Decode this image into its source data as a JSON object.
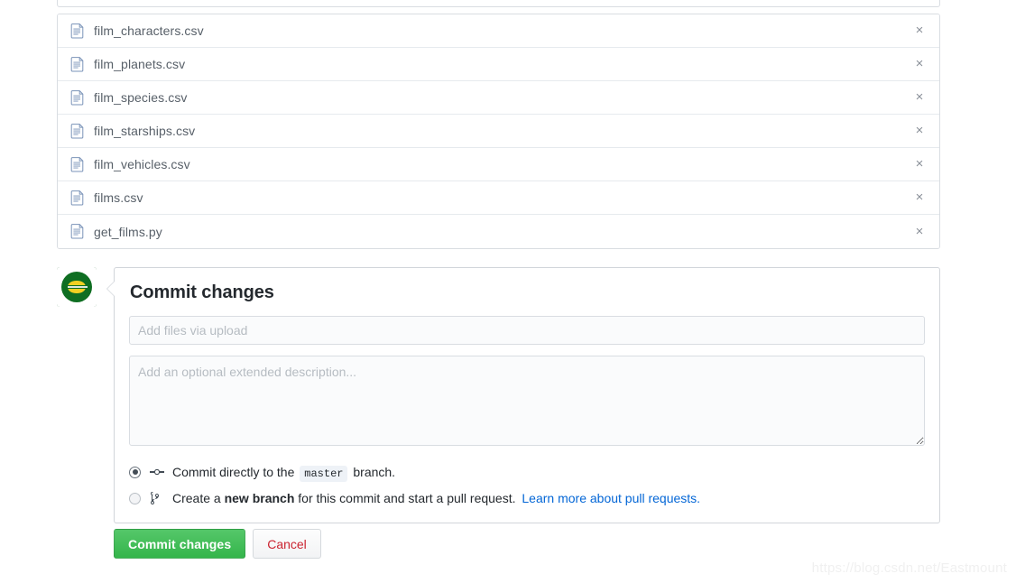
{
  "file_list": {
    "remove_icon": "close-icon",
    "file_icon": "file-document-icon",
    "remove_label": "×",
    "files": [
      {
        "name": "film_characters.csv"
      },
      {
        "name": "film_planets.csv"
      },
      {
        "name": "film_species.csv"
      },
      {
        "name": "film_starships.csv"
      },
      {
        "name": "film_vehicles.csv"
      },
      {
        "name": "films.csv"
      },
      {
        "name": "get_films.py"
      }
    ]
  },
  "avatar": {
    "icon": "user-avatar-logo",
    "colors": {
      "background": "#0b5c1f",
      "accent": "#f2d022"
    }
  },
  "commit_box": {
    "title": "Commit changes",
    "summary": {
      "value": "",
      "placeholder": "Add files via upload"
    },
    "description": {
      "value": "",
      "placeholder": "Add an optional extended description..."
    },
    "options": [
      {
        "id": "commit-directly",
        "selected": true,
        "icon": "git-commit-icon",
        "text_before": "Commit directly to the",
        "branch": "master",
        "text_after": "branch."
      },
      {
        "id": "create-new-branch",
        "selected": false,
        "icon": "git-branch-icon",
        "text_before": "Create a",
        "bold_text": "new branch",
        "text_after": "for this commit and start a pull request.",
        "link_text": "Learn more about pull requests."
      }
    ]
  },
  "actions": {
    "commit_label": "Commit changes",
    "cancel_label": "Cancel",
    "commit_color": "#2cbe4e",
    "cancel_color": "#cb2431"
  },
  "watermark": {
    "text": "https://blog.csdn.net/Eastmount"
  }
}
